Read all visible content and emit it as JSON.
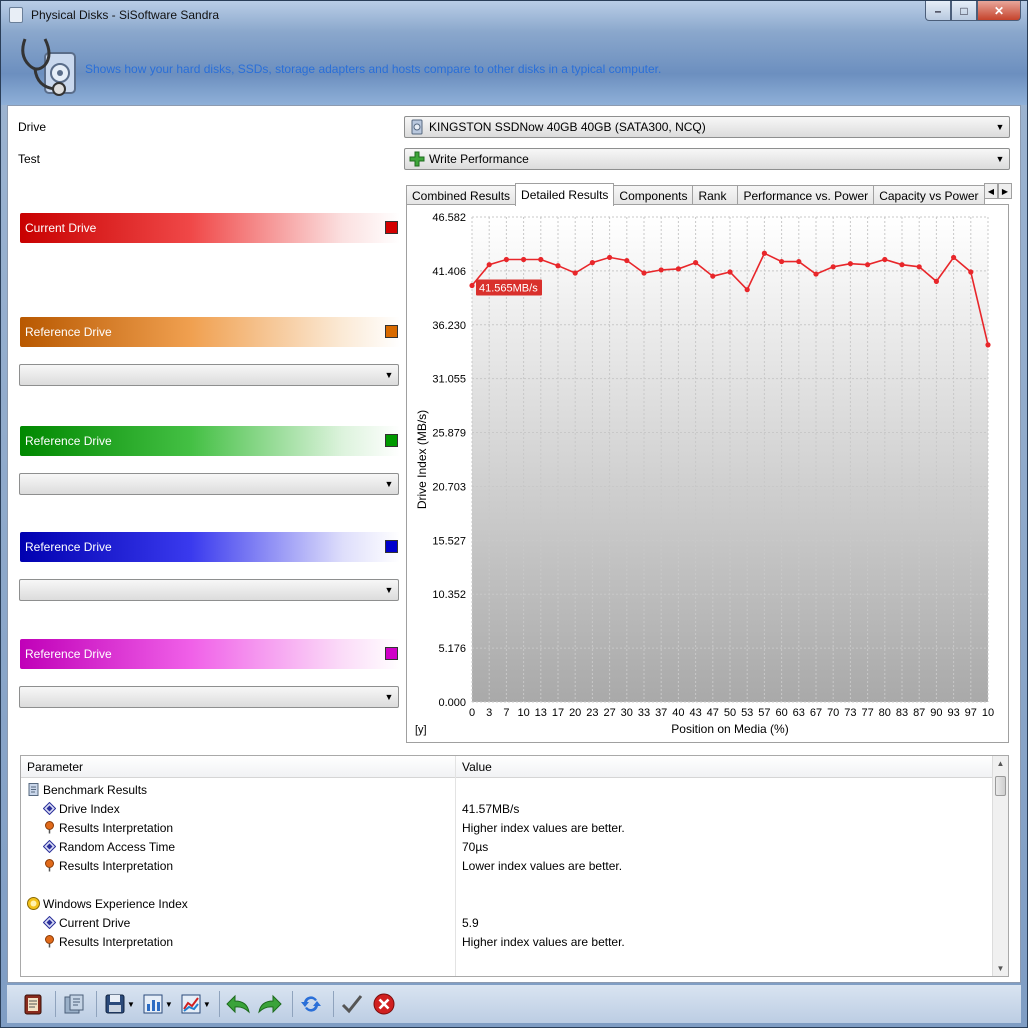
{
  "window": {
    "title": "Physical Disks - SiSoftware Sandra",
    "description": "Shows how your hard disks, SSDs, storage adapters and hosts compare to other disks in a typical computer.",
    "min_glyph": "–",
    "max_glyph": "□",
    "close_glyph": "✕"
  },
  "form": {
    "drive_label": "Drive",
    "drive_value": "KINGSTON SSDNow 40GB 40GB (SATA300, NCQ)",
    "test_label": "Test",
    "test_value": "Write Performance"
  },
  "drives": {
    "current": {
      "label": "Current Drive",
      "color": "#d40000"
    },
    "ref1": {
      "label": "Reference Drive",
      "color": "#d86a00"
    },
    "ref2": {
      "label": "Reference Drive",
      "color": "#009a00"
    },
    "ref3": {
      "label": "Reference Drive",
      "color": "#0000cc"
    },
    "ref4": {
      "label": "Reference Drive",
      "color": "#d000c8"
    }
  },
  "tabs": [
    "Combined Results",
    "Detailed Results",
    "Components",
    "Rank",
    "Performance vs. Power",
    "Capacity vs Power"
  ],
  "active_tab": 1,
  "chart_data": {
    "type": "line",
    "xlabel": "Position on Media (%)",
    "ylabel": "Drive Index (MB/s)",
    "corner_label": "[y]",
    "y_ticks": [
      "46.582",
      "41.406",
      "36.230",
      "31.055",
      "25.879",
      "20.703",
      "15.527",
      "10.352",
      "5.176",
      "0.000"
    ],
    "ylim": [
      0,
      46.582
    ],
    "x_ticks": [
      "0",
      "3",
      "7",
      "10",
      "13",
      "17",
      "20",
      "23",
      "27",
      "30",
      "33",
      "37",
      "40",
      "43",
      "47",
      "50",
      "53",
      "57",
      "60",
      "63",
      "67",
      "70",
      "73",
      "77",
      "80",
      "83",
      "87",
      "90",
      "93",
      "97",
      "10"
    ],
    "series": [
      {
        "color": "#e8262a",
        "values": [
          40.0,
          42.0,
          42.5,
          42.5,
          42.5,
          41.9,
          41.2,
          42.2,
          42.7,
          42.4,
          41.2,
          41.5,
          41.6,
          42.2,
          40.9,
          41.3,
          39.6,
          43.1,
          42.3,
          42.3,
          41.1,
          41.8,
          42.1,
          42.0,
          42.5,
          42.0,
          41.8,
          40.4,
          42.7,
          41.3,
          34.3
        ]
      }
    ],
    "annotation": "41.565MB/s",
    "grid": true
  },
  "table": {
    "col_parameter": "Parameter",
    "col_value": "Value",
    "rows": [
      {
        "param": "Benchmark Results",
        "value": "",
        "indent": 0,
        "icon": "document-icon"
      },
      {
        "param": "Drive Index",
        "value": "41.57MB/s",
        "indent": 1,
        "icon": "diamond-icon"
      },
      {
        "param": "Results Interpretation",
        "value": "Higher index values are better.",
        "indent": 1,
        "icon": "pin-icon"
      },
      {
        "param": "Random Access Time",
        "value": "70µs",
        "indent": 1,
        "icon": "diamond-icon"
      },
      {
        "param": "Results Interpretation",
        "value": "Lower index values are better.",
        "indent": 1,
        "icon": "pin-icon"
      },
      {
        "param": "",
        "value": "",
        "indent": 0,
        "icon": ""
      },
      {
        "param": "Windows Experience Index",
        "value": "",
        "indent": 0,
        "icon": "wei-icon"
      },
      {
        "param": "Current Drive",
        "value": "5.9",
        "indent": 1,
        "icon": "diamond-icon"
      },
      {
        "param": "Results Interpretation",
        "value": "Higher index values are better.",
        "indent": 1,
        "icon": "pin-icon"
      }
    ]
  },
  "toolbar": {
    "icons": [
      "report-icon",
      "options-icon",
      "save-icon",
      "chart-icon",
      "graph-icon",
      "back-icon",
      "forward-icon",
      "refresh-icon",
      "ok-icon",
      "cancel-icon"
    ]
  }
}
